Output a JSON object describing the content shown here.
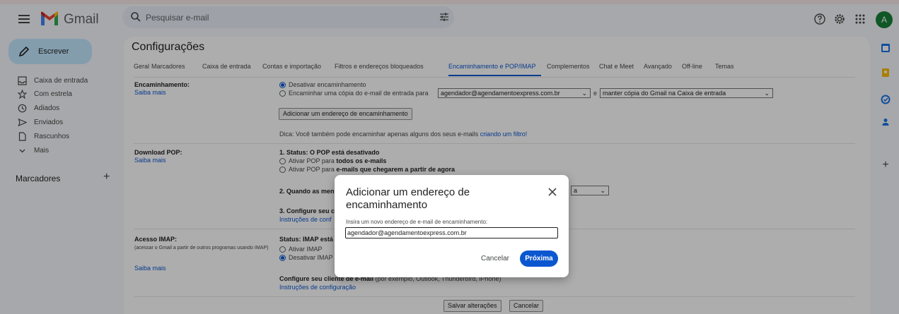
{
  "header": {
    "brand": "Gmail",
    "search_placeholder": "Pesquisar e-mail",
    "avatar_letter": "A",
    "icons": [
      "menu-icon",
      "gmail-logo-icon",
      "search-icon",
      "tune-icon",
      "help-icon",
      "settings-icon",
      "apps-icon"
    ]
  },
  "nav": {
    "compose_label": "Escrever",
    "items": [
      {
        "label": "Caixa de entrada",
        "icon": "inbox-icon"
      },
      {
        "label": "Com estrela",
        "icon": "star-icon"
      },
      {
        "label": "Adiados",
        "icon": "clock-icon"
      },
      {
        "label": "Enviados",
        "icon": "send-icon"
      },
      {
        "label": "Rascunhos",
        "icon": "draft-icon"
      },
      {
        "label": "Mais",
        "icon": "chevron-down-icon"
      }
    ],
    "labels_title": "Marcadores",
    "labels_add": "+"
  },
  "settings": {
    "title": "Configurações",
    "tabs": [
      {
        "label": "Geral",
        "active": false
      },
      {
        "label": "Marcadores",
        "active": false
      },
      {
        "label": "Caixa de entrada",
        "active": false
      },
      {
        "label": "Contas e importação",
        "active": false
      },
      {
        "label": "Filtros e endereços bloqueados",
        "active": false
      },
      {
        "label": "Encaminhamento e POP/IMAP",
        "active": true
      },
      {
        "label": "Complementos",
        "active": false
      },
      {
        "label": "Chat e Meet",
        "active": false
      },
      {
        "label": "Avançado",
        "active": false
      },
      {
        "label": "Off-line",
        "active": false
      },
      {
        "label": "Temas",
        "active": false
      }
    ],
    "forwarding": {
      "title": "Encaminhamento:",
      "learn_more": "Saiba mais",
      "opt_disable": "Desativar encaminhamento",
      "opt_forward_prefix": "Encaminhar uma cópia do e-mail de entrada para",
      "forward_address": "agendador@agendamentoexpress.com.br",
      "conj": "e",
      "keep_option": "manter cópia do Gmail na Caixa de entrada",
      "add_button": "Adicionar um endereço de encaminhamento",
      "tip_prefix": "Dica: Você também pode encaminhar apenas alguns dos seus e-mails",
      "tip_link": "criando um filtro!"
    },
    "pop": {
      "title": "Download POP:",
      "learn_more": "Saiba mais",
      "status": "1. Status: O POP está desativado",
      "opt_all_prefix": "Ativar POP para",
      "opt_all_bold": "todos os e-mails",
      "opt_new_prefix": "Ativar POP para",
      "opt_new_bold": "e-mails que chegarem a partir de agora",
      "step2": "2. Quando as men",
      "step3": "3. Configure seu c",
      "config_link": "Instruções de conf",
      "select_partial": "a"
    },
    "imap": {
      "title": "Acesso IMAP:",
      "desc": "(acessar o Gmail a partir de outros programas usando IMAP)",
      "learn_more": "Saiba mais",
      "status": "Status: IMAP está",
      "opt_enable": "Ativar IMAP",
      "opt_disable": "Desativar IMAP",
      "client_bold": "Configure seu cliente de e-mail",
      "client_rest": "(por exemplo, Outlook, Thunderbird, iPhone)",
      "config_link": "Instruções de configuração"
    },
    "save_button": "Salvar alterações",
    "cancel_button": "Cancelar"
  },
  "dialog": {
    "title": "Adicionar um endereço de encaminhamento",
    "prompt": "Insira um novo endereço de e-mail de encaminhamento:",
    "input_value": "agendador@agendamentoexpress.com.br",
    "cancel": "Cancelar",
    "next": "Próxima"
  },
  "side_panel": {
    "icons": [
      "calendar-icon",
      "keep-icon",
      "tasks-icon",
      "contacts-icon",
      "add-icon"
    ],
    "add_label": "+"
  },
  "colors": {
    "accent": "#0b57d0",
    "compose_bg": "#c2e7ff",
    "avatar_bg": "#188038"
  }
}
